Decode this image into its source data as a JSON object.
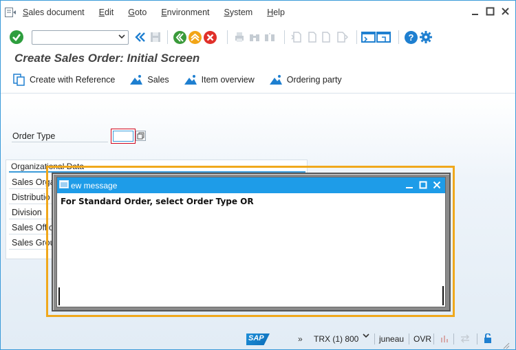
{
  "menu": {
    "items": [
      "Sales document",
      "Edit",
      "Goto",
      "Environment",
      "System",
      "Help"
    ]
  },
  "toolbar": {
    "command_field_value": ""
  },
  "page": {
    "title": "Create Sales Order: Initial Screen"
  },
  "app_toolbar": {
    "items": [
      "Create with Reference",
      "Sales",
      "Item overview",
      "Ordering party"
    ]
  },
  "form": {
    "order_type_label": "Order Type",
    "order_type_value": "",
    "org_data_title": "Organizational Data",
    "org_fields": [
      "Sales Orga",
      "Distributio",
      "Division",
      "Sales Offic",
      "Sales Grou"
    ]
  },
  "dialog": {
    "title": "ew message",
    "message": "For Standard Order, select Order Type OR"
  },
  "status": {
    "system": "TRX (1) 800",
    "host": "juneau",
    "mode": "OVR",
    "more": "»"
  },
  "colors": {
    "accent": "#1e9ce8",
    "focus_frame": "#f0a81c",
    "error_border": "#d0021b",
    "ok_green": "#2e9e3e",
    "cancel_red": "#e0302a",
    "back_green": "#3a9a3a",
    "exit_orange": "#f2a516"
  }
}
